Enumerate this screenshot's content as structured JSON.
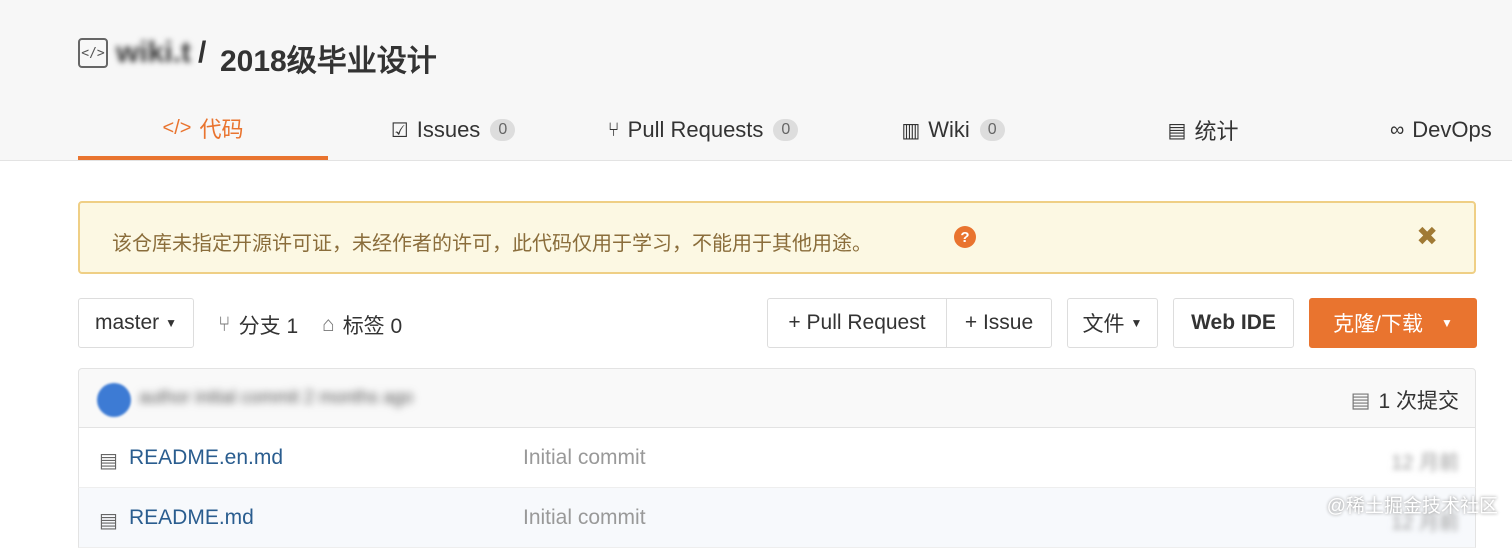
{
  "repo": {
    "owner": "wiki.t",
    "separator": "/",
    "name": "2018级毕业设计"
  },
  "tabs": [
    {
      "icon": "</>",
      "label": "代码",
      "count": null
    },
    {
      "icon": "☑",
      "label": "Issues",
      "count": "0"
    },
    {
      "icon": "⑂",
      "label": "Pull Requests",
      "count": "0"
    },
    {
      "icon": "▥",
      "label": "Wiki",
      "count": "0"
    },
    {
      "icon": "▤",
      "label": "统计",
      "count": null
    },
    {
      "icon": "∞",
      "label": "DevOps",
      "count": null
    }
  ],
  "notice": {
    "text": "该仓库未指定开源许可证，未经作者的许可，此代码仅用于学习，不能用于其他用途。",
    "help": "?",
    "close": "✖"
  },
  "toolbar": {
    "branch": "master",
    "branches": "分支 1",
    "tags": "标签 0",
    "pull_request": "+ Pull Request",
    "issue": "+ Issue",
    "files": "文件",
    "web_ide": "Web IDE",
    "clone": "克隆/下载"
  },
  "commit": {
    "summary": "author initial commit 2 months ago",
    "count": "1 次提交"
  },
  "files": [
    {
      "name": "README.en.md",
      "message": "Initial commit",
      "time": "12 月前"
    },
    {
      "name": "README.md",
      "message": "Initial commit",
      "time": "12 月前"
    }
  ],
  "watermark": "@稀土掘金技术社区",
  "colors": {
    "accent": "#e9742f",
    "notice_bg": "#fcf8e3",
    "link": "#2a5d8f"
  }
}
